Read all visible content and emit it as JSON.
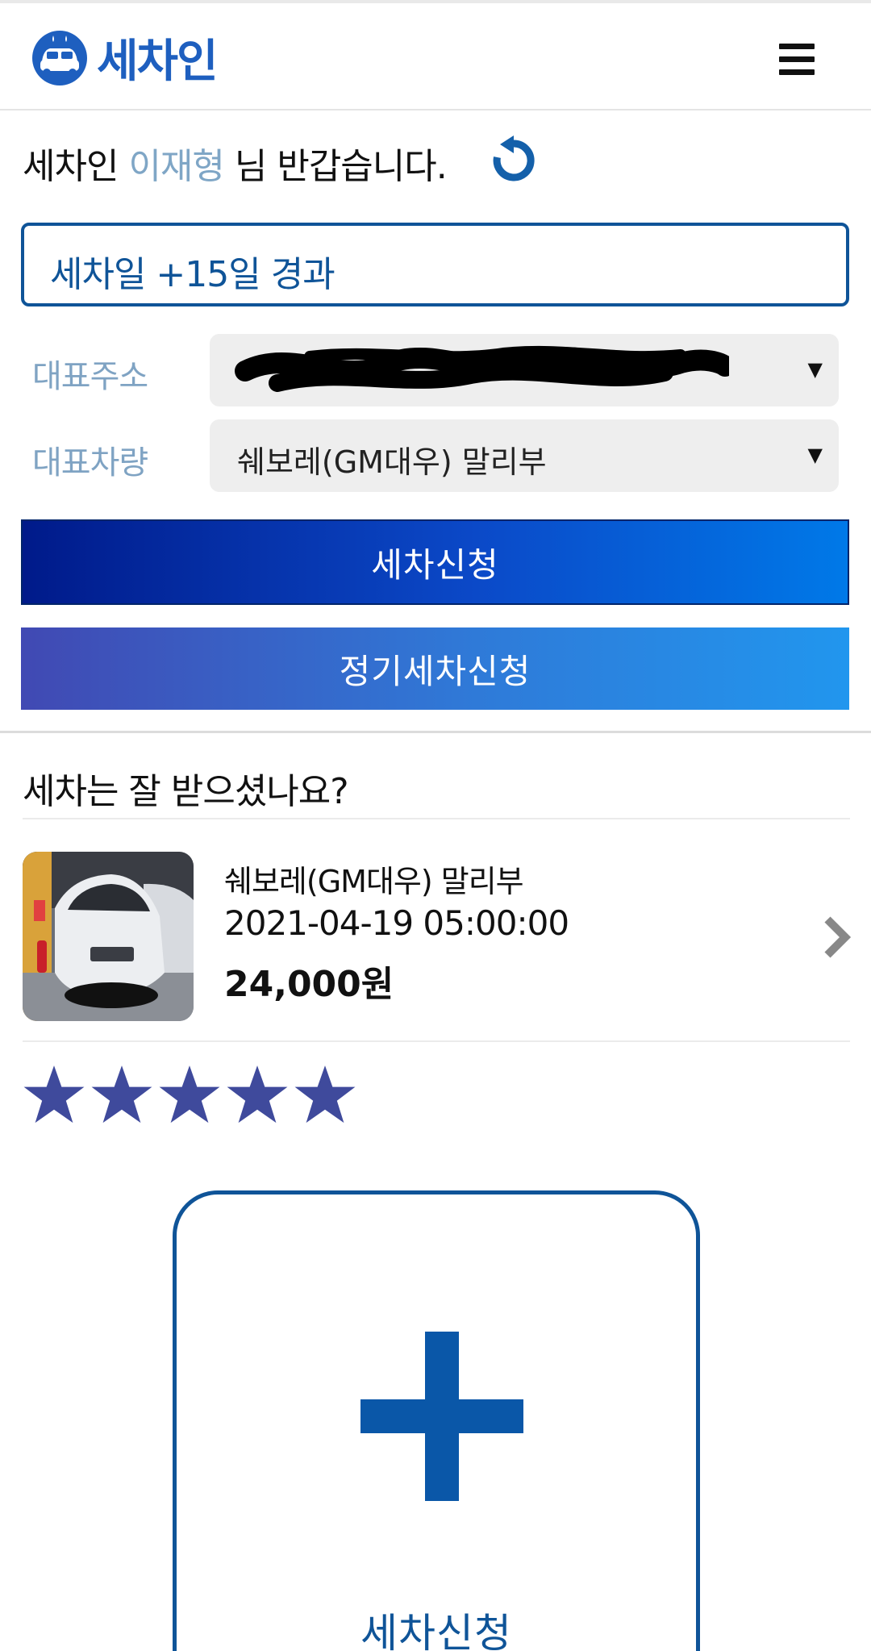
{
  "header": {
    "logo_text": "세차인",
    "brand_color": "#1e5fbf",
    "menu_icon": "hamburger-menu-icon"
  },
  "greeting": {
    "prefix": "세차인 ",
    "user_name": "이재형",
    "suffix": " 님 반갑습니다.",
    "refresh_icon": "refresh-icon"
  },
  "status_box": {
    "text": "세차일 +15일 경과"
  },
  "address": {
    "label": "대표주소",
    "value": ""
  },
  "vehicle": {
    "label": "대표차량",
    "value": "쉐보레(GM대우) 말리부"
  },
  "dropdown_caret": "▼",
  "buttons": {
    "wash_request": "세차신청",
    "regular_wash_request": "정기세차신청"
  },
  "review": {
    "title": "세차는 잘 받으셨나요?",
    "item": {
      "car_name": "쉐보레(GM대우) 말리부",
      "datetime": "2021-04-19 05:00:00",
      "price": "24,000원"
    },
    "rating": 5,
    "rating_max": 5,
    "star_color": "#3f4a9c"
  },
  "add_card": {
    "label": "세차신청",
    "accent_color": "#0a57a8"
  }
}
